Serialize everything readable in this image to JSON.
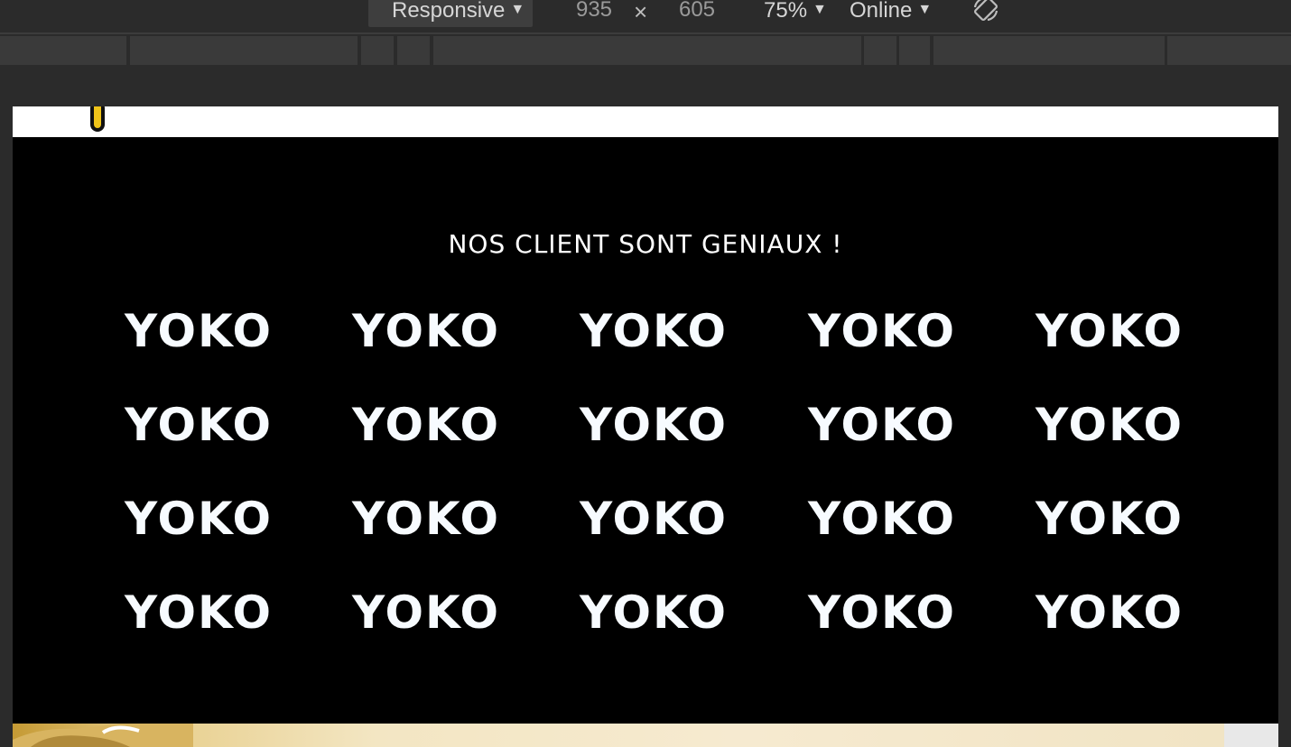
{
  "toolbar": {
    "device": "Responsive",
    "width": "935",
    "dimension_separator": "×",
    "height": "605",
    "zoom": "75%",
    "throttling": "Online",
    "caret": "▼",
    "rotate_icon": "rotate-icon"
  },
  "page": {
    "clients_title": "NOS CLIENT SONT GENIAUX !",
    "client_logos": [
      [
        "YOKO",
        "YOKO",
        "YOKO",
        "YOKO",
        "YOKO"
      ],
      [
        "YOKO",
        "YOKO",
        "YOKO",
        "YOKO",
        "YOKO"
      ],
      [
        "YOKO",
        "YOKO",
        "YOKO",
        "YOKO",
        "YOKO"
      ],
      [
        "YOKO",
        "YOKO",
        "YOKO",
        "YOKO",
        "YOKO"
      ]
    ]
  },
  "colors": {
    "toolbar_bg": "#2b2b2b",
    "section_bg": "#000000",
    "logo_text": "#f7fbff",
    "accent_gold": "#c59a34"
  }
}
